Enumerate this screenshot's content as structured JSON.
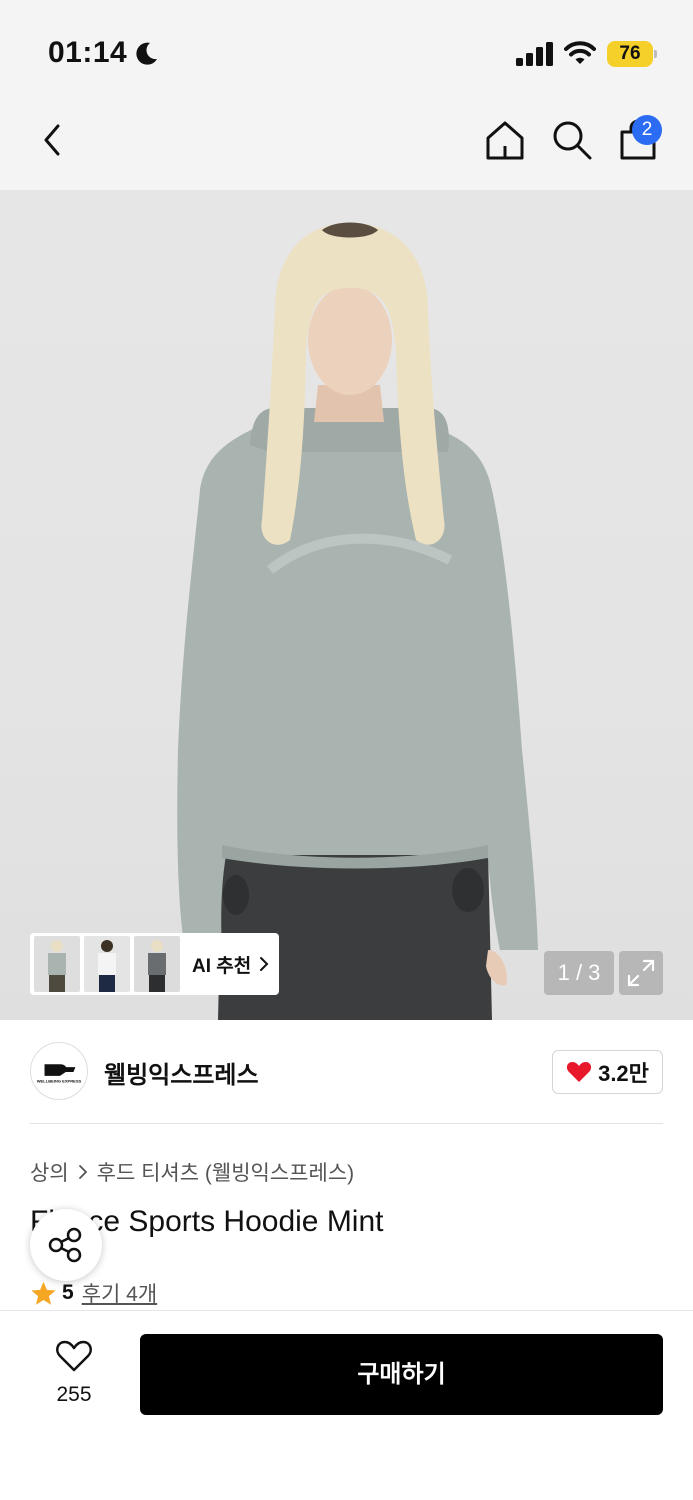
{
  "status_bar": {
    "time": "01:14",
    "battery": "76",
    "icons": [
      "moon-icon",
      "signal-icon",
      "wifi-icon",
      "battery-icon"
    ]
  },
  "header": {
    "cart_count": "2",
    "icons": [
      "back-arrow-icon",
      "home-icon",
      "search-icon",
      "shopping-bag-icon"
    ]
  },
  "gallery": {
    "ai_recommend_label": "AI 추천",
    "page_counter": "1 / 3"
  },
  "brand": {
    "name": "웰빙익스프레스",
    "logo_text": "WELLBEING EXPRESS",
    "likes": "3.2만"
  },
  "breadcrumb": {
    "items": [
      "상의",
      "후드 티셔츠 (웰빙익스프레스)"
    ]
  },
  "product": {
    "title": "Fleece Sports Hoodie Mint",
    "rating": "5",
    "review_label": "후기 4개"
  },
  "bottom_bar": {
    "wish_count": "255",
    "buy_label": "구매하기"
  },
  "colors": {
    "accent_blue": "#2b6cf2",
    "heart_red": "#e8182b",
    "star_orange": "#f5a623",
    "battery_yellow": "#f5cf2a",
    "buy_button": "#000000"
  }
}
